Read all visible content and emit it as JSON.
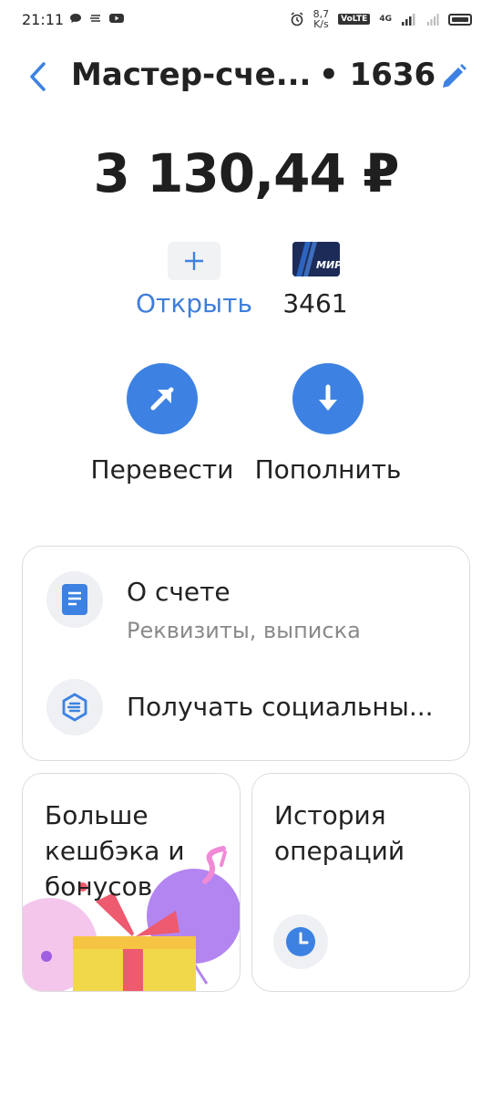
{
  "status_bar": {
    "time": "21:11",
    "speed_value": "8,7",
    "speed_unit": "K/s",
    "volte": "VoLTE",
    "network": "4G"
  },
  "header": {
    "title": "Мастер-сче...",
    "account_suffix": "• 1636"
  },
  "balance": "3 130,44 ₽",
  "shortcuts": {
    "open_label": "Открыть",
    "card_number": "3461",
    "card_brand": "МИР"
  },
  "actions": {
    "transfer_label": "Перевести",
    "topup_label": "Пополнить"
  },
  "info_card": {
    "about_title": "О счете",
    "about_subtitle": "Реквизиты, выписка",
    "social_title": "Получать социальны..."
  },
  "tiles": {
    "cashback_text": "Больше кешбэка и бонусов",
    "history_text": "История операций"
  },
  "colors": {
    "accent": "#3d82e2",
    "link": "#3f7ed8",
    "card_bg": "#1d2b59"
  }
}
